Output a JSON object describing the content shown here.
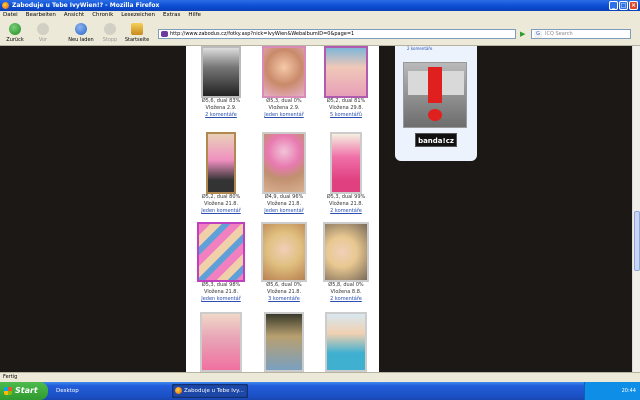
{
  "window": {
    "title": "Zaboduje u Tebe IvyWien!? - Mozilla Firefox"
  },
  "menu": [
    "Datei",
    "Bearbeiten",
    "Ansicht",
    "Chronik",
    "Lesezeichen",
    "Extras",
    "Hilfe"
  ],
  "nav": {
    "back": "Zurück",
    "forward": "Vor",
    "reload": "Neu laden",
    "stop": "Stopp",
    "home": "Startseite"
  },
  "url": "http://www.zabodus.cz/fotky.asp?nick=IvyWien&WebalbumID=0&page=1",
  "search": {
    "placeholder": "ICQ Search"
  },
  "gallery": {
    "rows": [
      [
        {
          "rating": "Ø5,6, dual 83%",
          "date": "Vložena 2.9.",
          "comments": "2 komentáře"
        },
        {
          "rating": "Ø5,3, dual 0%",
          "date": "Vložena 2.9.",
          "comments": "Jeden komentář"
        },
        {
          "rating": "Ø5,2, dual 81%",
          "date": "Vložena 29.8.",
          "comments": "5 komentářů"
        }
      ],
      [
        {
          "rating": "Ø5,2, dual 80%",
          "date": "Vložena 21.8.",
          "comments": "Jeden komentář"
        },
        {
          "rating": "Ø4,9, dual 96%",
          "date": "Vložena 21.8.",
          "comments": "Jeden komentář"
        },
        {
          "rating": "Ø5,3, dual 99%",
          "date": "Vložena 21.8.",
          "comments": "2 komentáře"
        }
      ],
      [
        {
          "rating": "Ø5,3, dual 98%",
          "date": "Vložena 21.8.",
          "comments": "Jeden komentář"
        },
        {
          "rating": "Ø5,6, dual 0%",
          "date": "Vložena 21.8.",
          "comments": "3 komentáře"
        },
        {
          "rating": "Ø5,8, dual 0%",
          "date": "Vložena 8.8.",
          "comments": "2 komentáře"
        }
      ]
    ]
  },
  "sidebar": {
    "toplink": "2 komentáře",
    "logo": "banda!cz"
  },
  "status": "Fertig",
  "taskbar": {
    "start": "Start",
    "desktop": "Desktop",
    "window": "Zaboduje u Tebe Ivy...",
    "clock": "20:44"
  }
}
